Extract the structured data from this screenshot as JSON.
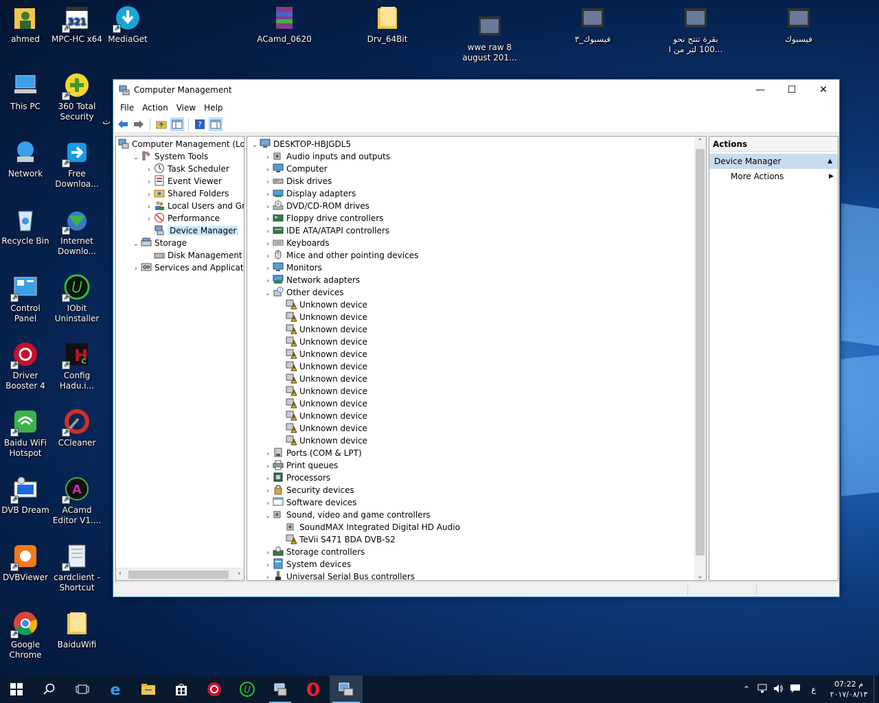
{
  "desktop": {
    "icons_left": [
      {
        "label": "ahmed",
        "icon": "folder-person-icon"
      },
      {
        "label": "MPC-HC x64",
        "icon": "mpc-icon"
      },
      {
        "label": "MediaGet",
        "icon": "mediaget-icon"
      },
      {
        "label": "This PC",
        "icon": "computer-icon"
      },
      {
        "label": "360 Total Security",
        "icon": "360-icon"
      },
      {
        "label": "Network",
        "icon": "network-icon"
      },
      {
        "label": "Free Downloa...",
        "icon": "free-download-icon"
      },
      {
        "label": "Recycle Bin",
        "icon": "recycle-bin-icon"
      },
      {
        "label": "Internet Downlo...",
        "icon": "idm-icon"
      },
      {
        "label": "Control Panel",
        "icon": "control-panel-icon"
      },
      {
        "label": "IObit Uninstaller",
        "icon": "iobit-icon"
      },
      {
        "label": "Driver Booster 4",
        "icon": "driver-booster-icon"
      },
      {
        "label": "Config Hadu.i...",
        "icon": "config-icon"
      },
      {
        "label": "Baidu WiFi Hotspot",
        "icon": "baidu-wifi-icon"
      },
      {
        "label": "CCleaner",
        "icon": "ccleaner-icon"
      },
      {
        "label": "DVB Dream",
        "icon": "dvb-dream-icon"
      },
      {
        "label": "ACamd Editor V1....",
        "icon": "acamd-icon"
      },
      {
        "label": "DVBViewer",
        "icon": "dvbviewer-icon"
      },
      {
        "label": "cardclient - Shortcut",
        "icon": "cardclient-icon"
      },
      {
        "label": "Google Chrome",
        "icon": "chrome-icon"
      },
      {
        "label": "BaiduWifi",
        "icon": "folder-icon"
      }
    ],
    "icons_top": [
      {
        "label": "ACamd_0620",
        "icon": "rar-icon"
      },
      {
        "label": "Drv_64Bit",
        "icon": "folder-icon"
      },
      {
        "label": "wwe raw 8 august 201...",
        "icon": "video-icon"
      },
      {
        "label": "فيسبوك_٣",
        "icon": "video-icon"
      },
      {
        "label": "بقرة تنتج نحو 100 لتر من ا...",
        "icon": "video-icon"
      },
      {
        "label": "فيسبوك",
        "icon": "video-icon"
      }
    ],
    "partial_label": "ت"
  },
  "window": {
    "title": "Computer Management",
    "minimize": "—",
    "maximize": "☐",
    "close": "✕",
    "menu": [
      "File",
      "Action",
      "View",
      "Help"
    ]
  },
  "left_tree": [
    {
      "label": "Computer Management (Local",
      "level": 0,
      "exp": "",
      "icon": "computer-management-icon"
    },
    {
      "label": "System Tools",
      "level": 1,
      "exp": "⌄",
      "icon": "tools-icon"
    },
    {
      "label": "Task Scheduler",
      "level": 2,
      "exp": "›",
      "icon": "clock-icon"
    },
    {
      "label": "Event Viewer",
      "level": 2,
      "exp": "›",
      "icon": "event-viewer-icon"
    },
    {
      "label": "Shared Folders",
      "level": 2,
      "exp": "›",
      "icon": "shared-folder-icon"
    },
    {
      "label": "Local Users and Groups",
      "level": 2,
      "exp": "›",
      "icon": "users-icon"
    },
    {
      "label": "Performance",
      "level": 2,
      "exp": "›",
      "icon": "performance-icon"
    },
    {
      "label": "Device Manager",
      "level": 2,
      "exp": "",
      "icon": "device-manager-icon",
      "selected": true
    },
    {
      "label": "Storage",
      "level": 1,
      "exp": "⌄",
      "icon": "storage-icon"
    },
    {
      "label": "Disk Management",
      "level": 2,
      "exp": "",
      "icon": "disk-icon"
    },
    {
      "label": "Services and Applications",
      "level": 1,
      "exp": "›",
      "icon": "services-icon"
    }
  ],
  "device_tree": {
    "root": "DESKTOP-HBJGDL5",
    "items": [
      {
        "label": "Audio inputs and outputs",
        "level": 1,
        "exp": "›",
        "icon": "speaker-icon"
      },
      {
        "label": "Computer",
        "level": 1,
        "exp": "›",
        "icon": "monitor-icon"
      },
      {
        "label": "Disk drives",
        "level": 1,
        "exp": "›",
        "icon": "disk-drive-icon"
      },
      {
        "label": "Display adapters",
        "level": 1,
        "exp": "›",
        "icon": "display-adapter-icon"
      },
      {
        "label": "DVD/CD-ROM drives",
        "level": 1,
        "exp": "›",
        "icon": "dvd-icon"
      },
      {
        "label": "Floppy drive controllers",
        "level": 1,
        "exp": "›",
        "icon": "floppy-controller-icon"
      },
      {
        "label": "IDE ATA/ATAPI controllers",
        "level": 1,
        "exp": "›",
        "icon": "ide-icon"
      },
      {
        "label": "Keyboards",
        "level": 1,
        "exp": "›",
        "icon": "keyboard-icon"
      },
      {
        "label": "Mice and other pointing devices",
        "level": 1,
        "exp": "›",
        "icon": "mouse-icon"
      },
      {
        "label": "Monitors",
        "level": 1,
        "exp": "›",
        "icon": "monitor-icon"
      },
      {
        "label": "Network adapters",
        "level": 1,
        "exp": "›",
        "icon": "network-adapter-icon"
      },
      {
        "label": "Other devices",
        "level": 1,
        "exp": "⌄",
        "icon": "unknown-category-icon"
      },
      {
        "label": "Unknown device",
        "level": 2,
        "exp": "",
        "icon": "warning-device-icon"
      },
      {
        "label": "Unknown device",
        "level": 2,
        "exp": "",
        "icon": "warning-device-icon"
      },
      {
        "label": "Unknown device",
        "level": 2,
        "exp": "",
        "icon": "warning-device-icon"
      },
      {
        "label": "Unknown device",
        "level": 2,
        "exp": "",
        "icon": "warning-device-icon"
      },
      {
        "label": "Unknown device",
        "level": 2,
        "exp": "",
        "icon": "warning-device-icon"
      },
      {
        "label": "Unknown device",
        "level": 2,
        "exp": "",
        "icon": "warning-device-icon"
      },
      {
        "label": "Unknown device",
        "level": 2,
        "exp": "",
        "icon": "warning-device-icon"
      },
      {
        "label": "Unknown device",
        "level": 2,
        "exp": "",
        "icon": "warning-device-icon"
      },
      {
        "label": "Unknown device",
        "level": 2,
        "exp": "",
        "icon": "warning-device-icon"
      },
      {
        "label": "Unknown device",
        "level": 2,
        "exp": "",
        "icon": "warning-device-icon"
      },
      {
        "label": "Unknown device",
        "level": 2,
        "exp": "",
        "icon": "warning-device-icon"
      },
      {
        "label": "Unknown device",
        "level": 2,
        "exp": "",
        "icon": "warning-device-icon"
      },
      {
        "label": "Ports (COM & LPT)",
        "level": 1,
        "exp": "›",
        "icon": "port-icon"
      },
      {
        "label": "Print queues",
        "level": 1,
        "exp": "›",
        "icon": "printer-icon"
      },
      {
        "label": "Processors",
        "level": 1,
        "exp": "›",
        "icon": "processor-icon"
      },
      {
        "label": "Security devices",
        "level": 1,
        "exp": "›",
        "icon": "security-device-icon"
      },
      {
        "label": "Software devices",
        "level": 1,
        "exp": "›",
        "icon": "software-device-icon"
      },
      {
        "label": "Sound, video and game controllers",
        "level": 1,
        "exp": "⌄",
        "icon": "speaker-icon"
      },
      {
        "label": "SoundMAX Integrated Digital HD Audio",
        "level": 2,
        "exp": "",
        "icon": "speaker-icon"
      },
      {
        "label": "TeVii S471 BDA DVB-S2",
        "level": 2,
        "exp": "",
        "icon": "warning-device-icon"
      },
      {
        "label": "Storage controllers",
        "level": 1,
        "exp": "›",
        "icon": "storage-controller-icon"
      },
      {
        "label": "System devices",
        "level": 1,
        "exp": "›",
        "icon": "system-device-icon"
      },
      {
        "label": "Universal Serial Bus controllers",
        "level": 1,
        "exp": "›",
        "icon": "usb-icon"
      }
    ]
  },
  "actions": {
    "header": "Actions",
    "section": "Device Manager",
    "item": "More Actions"
  },
  "taskbar": {
    "items": [
      "start-icon",
      "search-icon",
      "task-view-icon",
      "edge-icon",
      "file-explorer-icon",
      "store-icon",
      "driver-booster-icon",
      "iobit-icon",
      "cardclient-icon",
      "opera-icon",
      "computer-management-icon"
    ],
    "time": "07:22 م",
    "date": "٢٠١٧/٠٨/١٣",
    "lang": "ع"
  }
}
